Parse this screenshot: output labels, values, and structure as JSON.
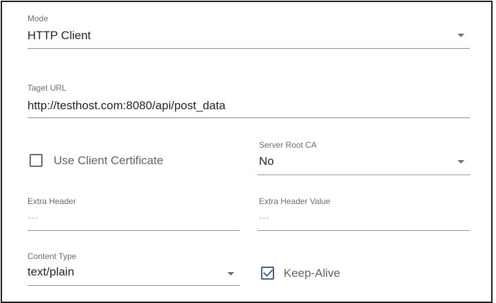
{
  "mode": {
    "label": "Mode",
    "value": "HTTP Client"
  },
  "target_url": {
    "label": "Taget URL",
    "value": "http://testhost.com:8080/api/post_data"
  },
  "use_client_certificate": {
    "label": "Use Client Certificate",
    "checked": false
  },
  "server_root_ca": {
    "label": "Server Root CA",
    "value": "No"
  },
  "extra_header": {
    "label": "Extra Header",
    "placeholder": "---"
  },
  "extra_header_value": {
    "label": "Extra Header Value",
    "placeholder": "---"
  },
  "content_type": {
    "label": "Content Type",
    "value": "text/plain"
  },
  "keep_alive": {
    "label": "Keep-Alive",
    "checked": true
  },
  "colors": {
    "checkbox_checked": "#3f5f8f",
    "checkbox_unchecked": "#6a6a6a"
  },
  "icons": {
    "dropdown": "caret-down-icon",
    "checkbox_empty": "checkbox-empty-icon",
    "checkbox_checked": "checkbox-checked-icon"
  }
}
